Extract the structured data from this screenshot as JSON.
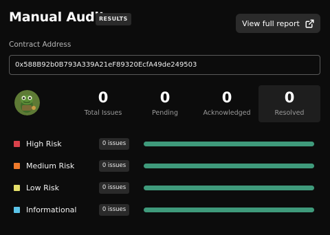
{
  "header": {
    "title": "Manual Audit",
    "badge": "RESULTS",
    "report_button_label": "View full report"
  },
  "contract": {
    "label": "Contract Address",
    "address": "0x588B92b0B793A339A21eF89320EcfA49de249503"
  },
  "stats": [
    {
      "value": "0",
      "label": "Total Issues"
    },
    {
      "value": "0",
      "label": "Pending"
    },
    {
      "value": "0",
      "label": "Acknowledged"
    },
    {
      "value": "0",
      "label": "Resolved"
    }
  ],
  "risks": [
    {
      "label": "High Risk",
      "count": "0 issues",
      "color": "#d9424b",
      "progress": 1.0
    },
    {
      "label": "Medium Risk",
      "count": "0 issues",
      "color": "#ef7a2b",
      "progress": 1.0
    },
    {
      "label": "Low Risk",
      "count": "0 issues",
      "color": "#e4df6a",
      "progress": 1.0
    },
    {
      "label": "Informational",
      "count": "0 issues",
      "color": "#5bc4e8",
      "progress": 1.0
    }
  ],
  "colors": {
    "background": "#0c0c0c",
    "bar_fill": "#3f9a7b",
    "bar_track": "#1f3b31"
  },
  "icons": {
    "report_button": "external-link-icon",
    "avatar": "frog-avatar"
  }
}
